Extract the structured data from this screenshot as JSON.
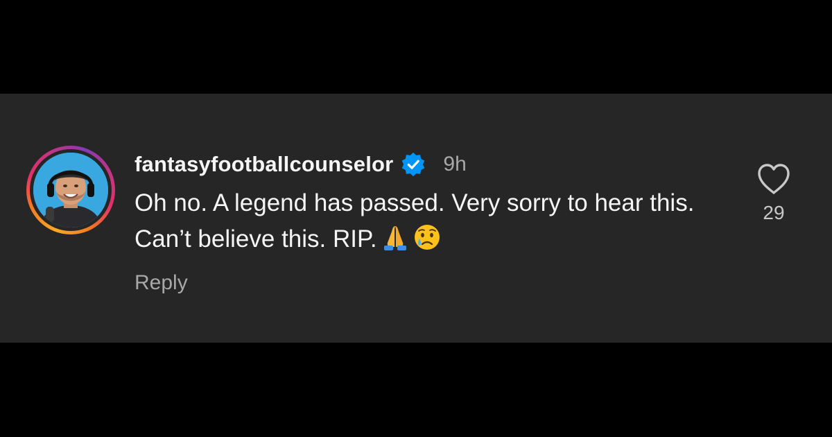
{
  "comment": {
    "username": "fantasyfootballcounselor",
    "verified": true,
    "timestamp": "9h",
    "text": "Oh no. A legend has passed. Very sorry to hear this. Can’t believe this. RIP.",
    "emojis": [
      "folded-hands-emoji",
      "crying-face-emoji"
    ],
    "reply_label": "Reply"
  },
  "likes": {
    "count": "29",
    "icon": "heart-outline-icon"
  },
  "avatar": {
    "icon": "user-avatar",
    "ring_colors": [
      "#f9a825",
      "#e1306c",
      "#c13584",
      "#833ab4"
    ],
    "background": "#3aa8e0"
  },
  "colors": {
    "page_background": "#000000",
    "panel_background": "#262626",
    "primary_text": "#f5f5f5",
    "secondary_text": "#a8a8a8",
    "verified_badge": "#0095f6"
  }
}
